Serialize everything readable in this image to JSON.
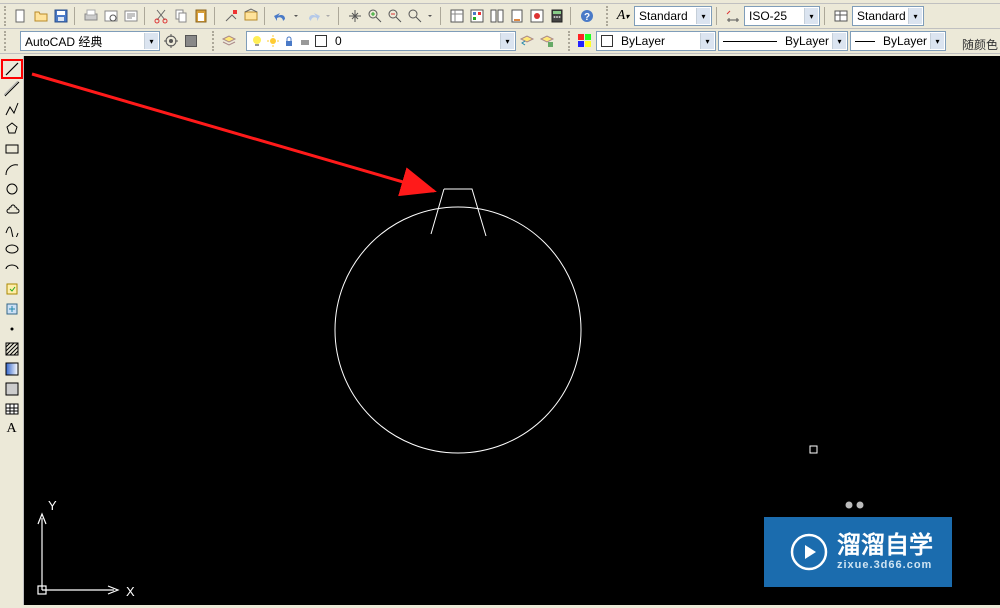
{
  "topbar": {
    "text_style": "Standard",
    "dim_style": "ISO-25",
    "table_style": "Standard"
  },
  "workspace": {
    "label": "AutoCAD 经典"
  },
  "layer": {
    "current": "0"
  },
  "props": {
    "color": "ByLayer",
    "linetype": "ByLayer",
    "lineweight": "ByLayer",
    "bycolor_label": "随颜色"
  },
  "ucs": {
    "x": "X",
    "y": "Y"
  },
  "watermark": {
    "title": "溜溜自学",
    "sub": "zixue.3d66.com"
  },
  "draw_tools": [
    {
      "name": "line",
      "selected": true
    },
    {
      "name": "construction-line"
    },
    {
      "name": "polyline"
    },
    {
      "name": "polygon"
    },
    {
      "name": "rectangle"
    },
    {
      "name": "arc"
    },
    {
      "name": "circle"
    },
    {
      "name": "revcloud"
    },
    {
      "name": "spline"
    },
    {
      "name": "ellipse"
    },
    {
      "name": "ellipse-arc"
    },
    {
      "name": "insert-block"
    },
    {
      "name": "make-block"
    },
    {
      "name": "point"
    },
    {
      "name": "hatch"
    },
    {
      "name": "gradient"
    },
    {
      "name": "region"
    },
    {
      "name": "table"
    },
    {
      "name": "text"
    }
  ]
}
